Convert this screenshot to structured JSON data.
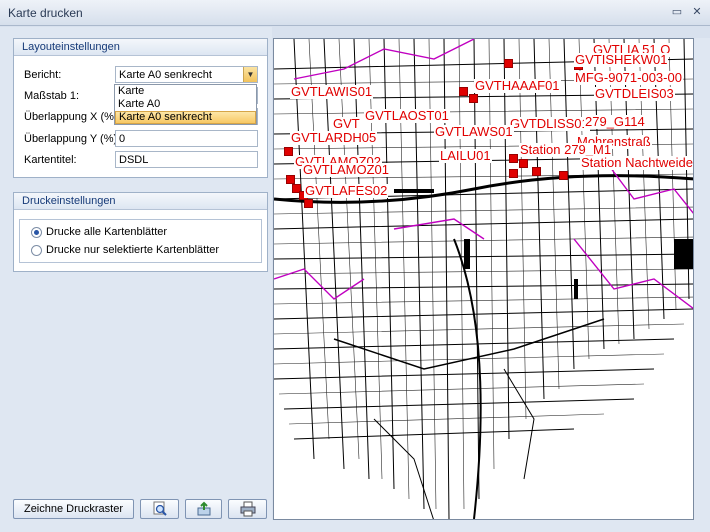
{
  "window": {
    "title": "Karte drucken",
    "restore_glyph": "▭",
    "close_glyph": "✕"
  },
  "layout": {
    "header": "Layouteinstellungen",
    "bericht_label": "Bericht:",
    "bericht_value": "Karte A0 senkrecht",
    "massstab_label": "Maßstab 1:",
    "ueberlappung_x_label": "Überlappung X (%):",
    "ueberlappung_y_label": "Überlappung Y (%):",
    "ueberlappung_y_value": "0",
    "kartentitel_label": "Kartentitel:",
    "kartentitel_value": "DSDL",
    "dropdown_options": [
      "Karte",
      "Karte A0",
      "Karte A0 senkrecht"
    ]
  },
  "druck": {
    "header": "Druckeinstellungen",
    "option_all": "Drucke alle Kartenblätter",
    "option_selected": "Drucke nur selektierte Kartenblätter"
  },
  "buttons": {
    "zeichne": "Zeichne Druckraster"
  },
  "map_labels": [
    "GVTLAWIS01",
    "GVTHAAAF01",
    "GVTLAOST01",
    "GVTLAWS01",
    "GVTLARDH05",
    "LAILU01",
    "Station 279_M1",
    "Station Nachtweide",
    "GVTLAMOZ01",
    "GVTLAFES02",
    "279_G114",
    "MFG-9071-003-00",
    "GVTDLEIS03",
    "GVTISHEKW01",
    "Mohrenstraß",
    "GVTLAMOZ02",
    "GVT",
    "GVTLIA 51 O",
    "GVTDLISS01"
  ],
  "colors": {
    "label_red": "#e00000",
    "boundary_magenta": "#c000c0",
    "accent_blue": "#163a78"
  }
}
